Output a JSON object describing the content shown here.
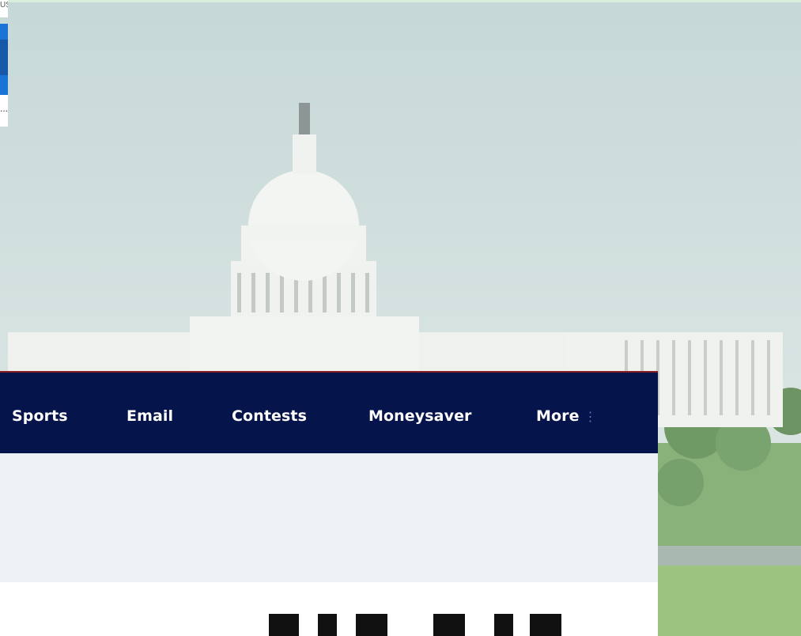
{
  "left_chrome": {
    "top_text": "US",
    "bottom_text": "..."
  },
  "nav": {
    "items": [
      {
        "label": "Sports"
      },
      {
        "label": "Email"
      },
      {
        "label": "Contests"
      },
      {
        "label": "Moneysaver"
      },
      {
        "label": "More"
      }
    ],
    "more_icon": "⋮"
  },
  "colors": {
    "navbar_bg": "#05144a",
    "navbar_border": "#8a1d24",
    "band_bg": "#edf1f5",
    "sky": "#c9d9d9"
  }
}
